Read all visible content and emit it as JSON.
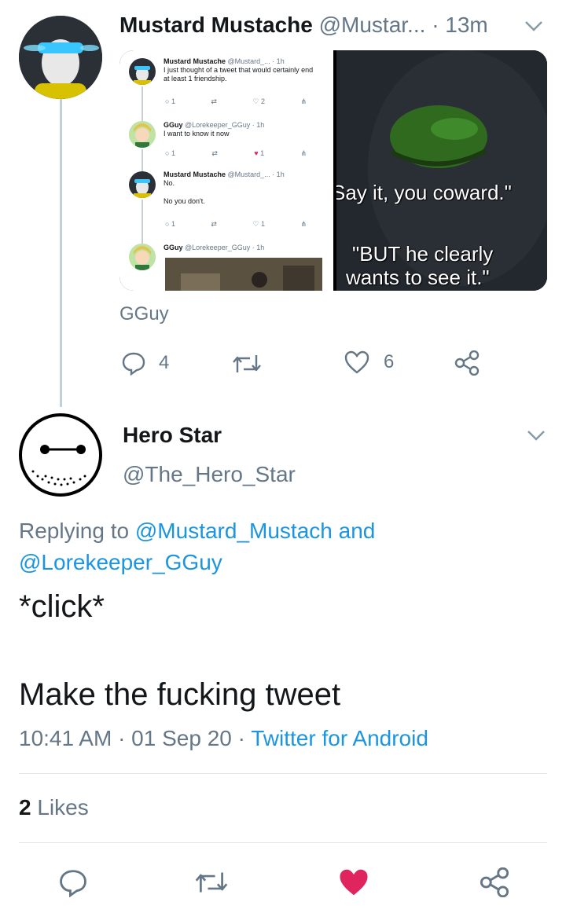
{
  "parent_tweet": {
    "name": "Mustard Mustache",
    "handle": "@Mustar...",
    "time": "· 13m",
    "quoted_label": "GGuy",
    "counts": {
      "replies": "4",
      "likes": "6"
    },
    "media_left": {
      "rows": [
        {
          "name": "Mustard Mustache",
          "meta": "@Mustard_... · 1h",
          "text": "I just thought of a tweet that would certainly end at least 1 friendship.",
          "reply": "1",
          "like": "2"
        },
        {
          "name": "GGuy",
          "meta": "@Lorekeeper_GGuy · 1h",
          "text": "I want to know it now",
          "reply": "1",
          "like": "1"
        },
        {
          "name": "Mustard Mustache",
          "meta": "@Mustard_... · 1h",
          "text": "No.",
          "text2": "No you don't.",
          "reply": "1",
          "like": "1"
        },
        {
          "name": "GGuy",
          "meta": "@Lorekeeper_GGuy · 1h"
        }
      ]
    },
    "media_right": {
      "caption_top": "Say it, you coward.\"",
      "caption_bottom_1": "\"BUT he clearly",
      "caption_bottom_2": "wants to see it.\""
    }
  },
  "main_tweet": {
    "name": "Hero Star",
    "handle": "@The_Hero_Star",
    "replying_prefix": "Replying to",
    "replying_user_1": "@Mustard_Mustach",
    "replying_and": "and",
    "replying_user_2": "@Lorekeeper_GGuy",
    "text_line_1": "*click*",
    "text_line_2": "Make the fucking tweet",
    "timestamp": "10:41 AM · 01 Sep 20 ·",
    "source": "Twitter for Android",
    "likes_count": "2",
    "likes_label": "Likes"
  },
  "colors": {
    "link": "#1b95e0",
    "muted": "#657786",
    "like_active": "#e0245e"
  }
}
